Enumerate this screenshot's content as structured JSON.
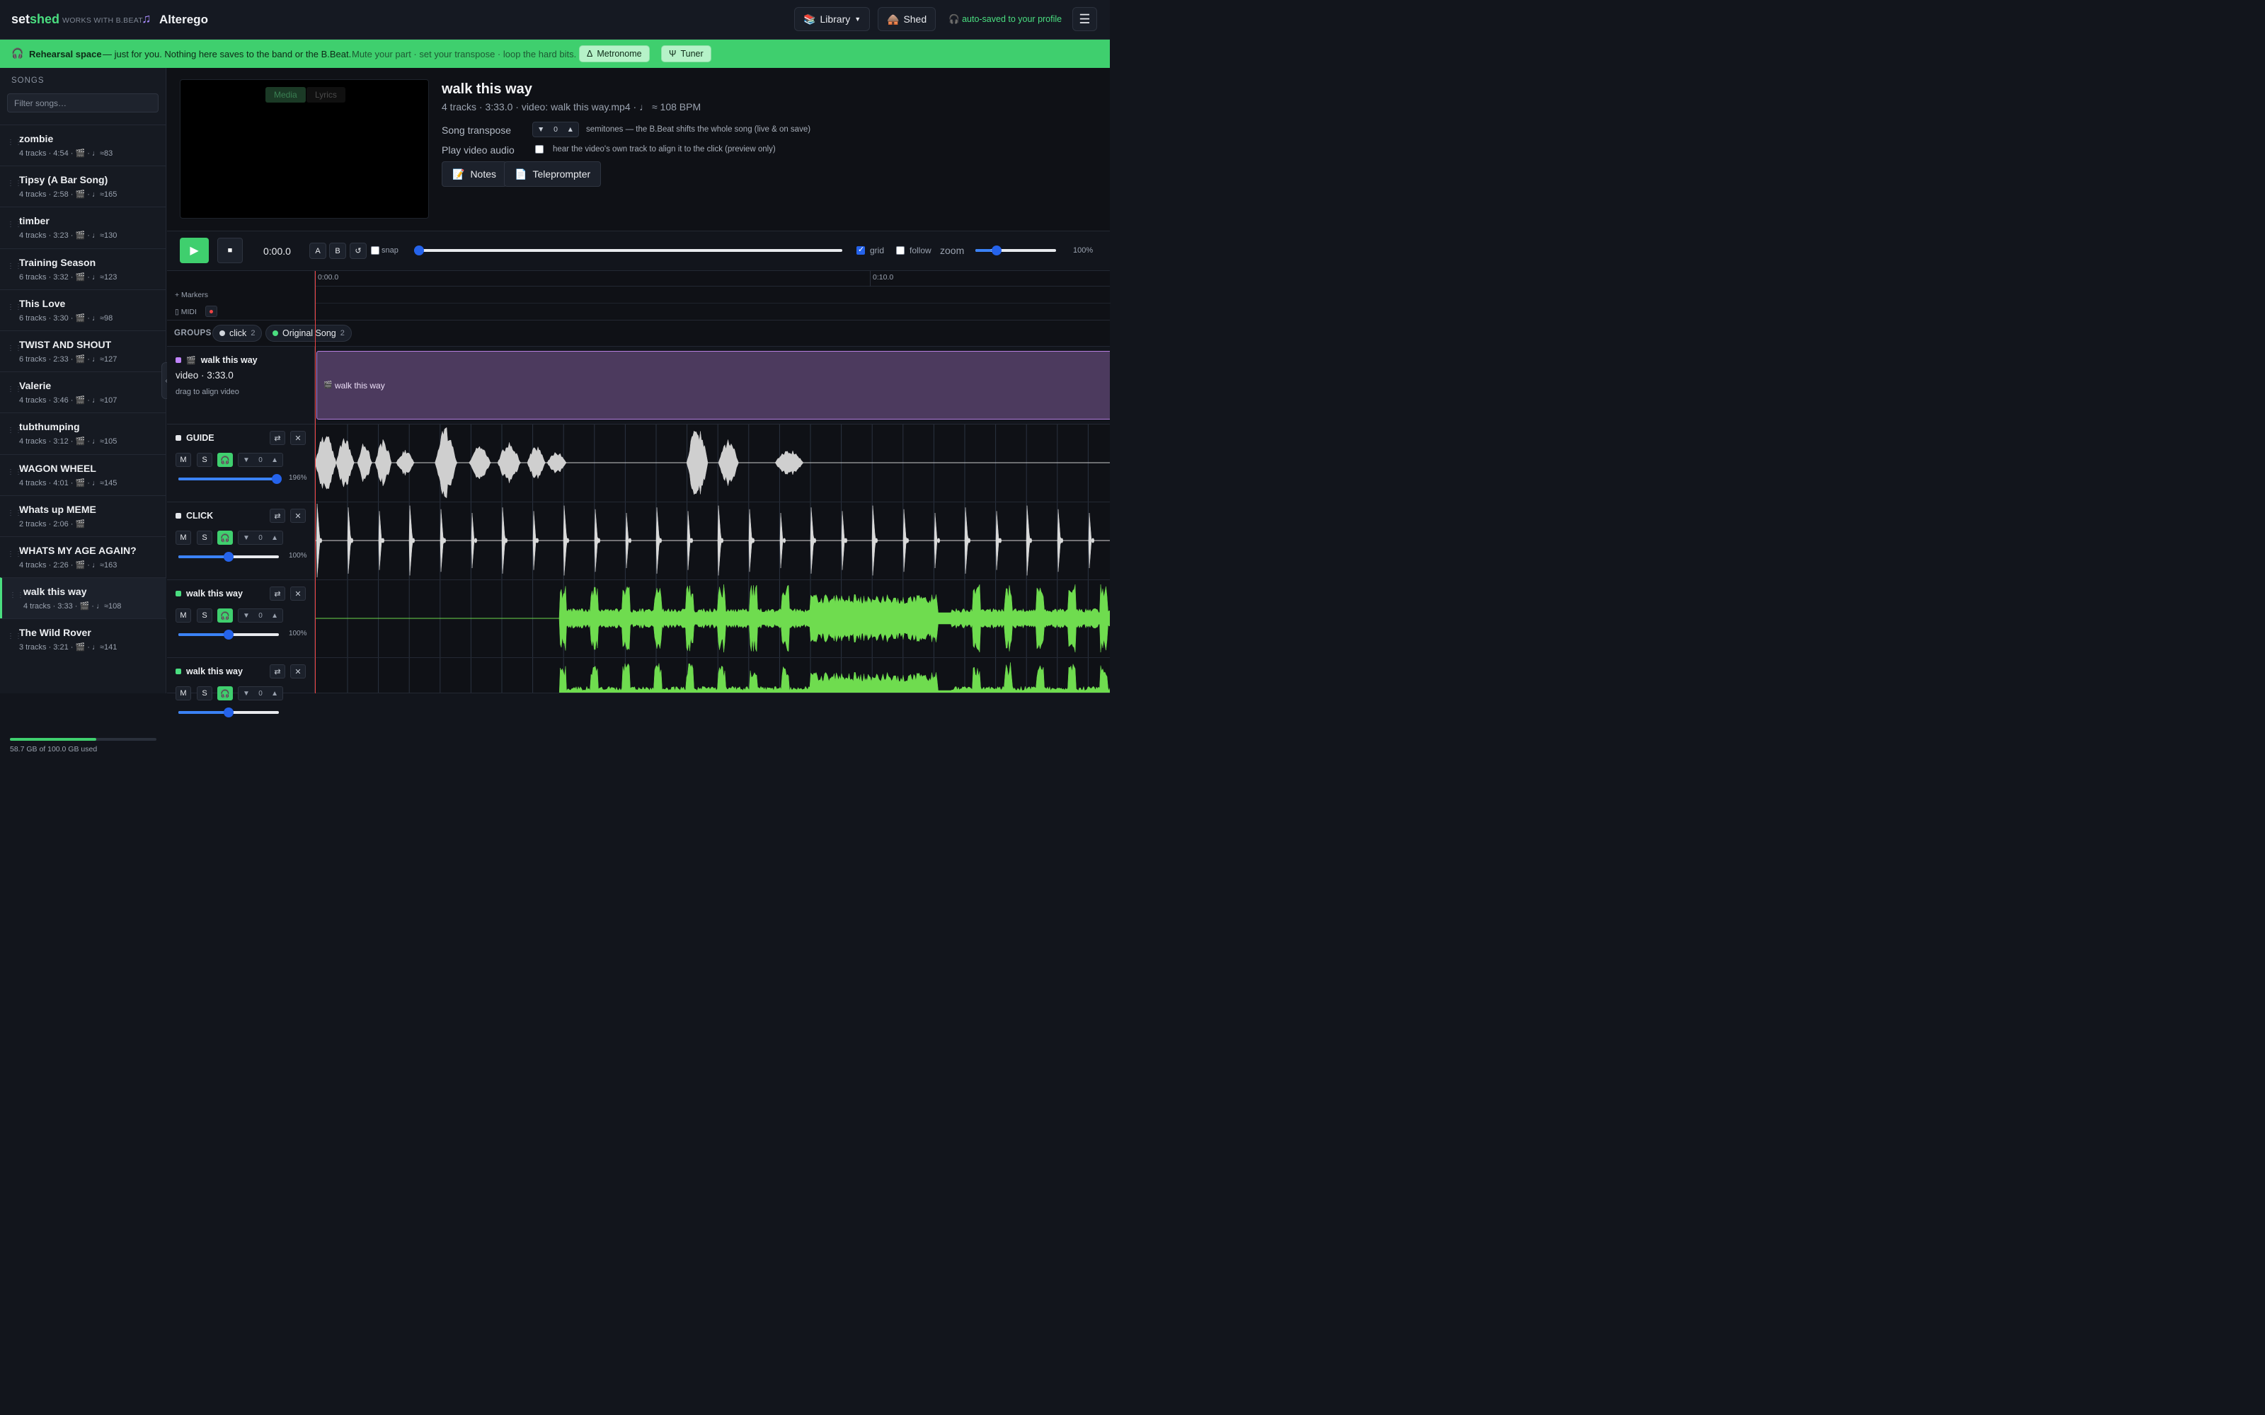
{
  "header": {
    "logo_a": "set",
    "logo_b": "shed",
    "works_with": "WORKS WITH B.BEAT",
    "band_name": "Alterego",
    "library_label": "Library",
    "shed_label": "Shed",
    "saved_status": "auto-saved to your profile"
  },
  "banner": {
    "bold": "Rehearsal space",
    "text": "— just for you. Nothing here saves to the band or the B.Beat.",
    "muted": "Mute your part · set your transpose · loop the hard bits.",
    "metronome_label": "Metronome",
    "tuner_label": "Tuner"
  },
  "sidebar": {
    "heading": "SONGS",
    "filter_placeholder": "Filter songs…",
    "songs": [
      {
        "title": "zombie",
        "meta": "4 tracks · 4:54 · 🎬 · ♩≈83"
      },
      {
        "title": "Tipsy (A Bar Song)",
        "meta": "4 tracks · 2:58 · 🎬 · ♩≈165"
      },
      {
        "title": "timber",
        "meta": "4 tracks · 3:23 · 🎬 · ♩≈130"
      },
      {
        "title": "Training Season",
        "meta": "6 tracks · 3:32 · 🎬 · ♩≈123"
      },
      {
        "title": "This Love",
        "meta": "6 tracks · 3:30 · 🎬 · ♩≈98"
      },
      {
        "title": "TWIST AND SHOUT",
        "meta": "6 tracks · 2:33 · 🎬 · ♩≈127"
      },
      {
        "title": "Valerie",
        "meta": "4 tracks · 3:46 · 🎬 · ♩≈107"
      },
      {
        "title": "tubthumping",
        "meta": "4 tracks · 3:12 · 🎬 · ♩≈105"
      },
      {
        "title": "WAGON WHEEL",
        "meta": "4 tracks · 4:01 · 🎬 · ♩≈145"
      },
      {
        "title": "Whats up MEME",
        "meta": "2 tracks · 2:06 · 🎬"
      },
      {
        "title": "WHATS MY AGE AGAIN?",
        "meta": "4 tracks · 2:26 · 🎬 · ♩≈163"
      },
      {
        "title": "walk this way",
        "meta": "4 tracks · 3:33 · 🎬 · ♩≈108",
        "active": true
      },
      {
        "title": "The Wild Rover",
        "meta": "3 tracks · 3:21 · 🎬 · ♩≈141"
      }
    ],
    "storage_text": "58.7 GB of 100.0 GB used",
    "storage_fraction": 0.587
  },
  "media": {
    "tab_media": "Media",
    "tab_lyrics": "Lyrics"
  },
  "song": {
    "title": "walk this way",
    "meta": "4 tracks · 3:33.0 · video: walk this way.mp4 · ♩ ≈ 108 BPM",
    "transpose_label": "Song transpose",
    "transpose_value": "0",
    "transpose_hint": "semitones — the B.Beat shifts the whole song (live & on save)",
    "video_audio_label": "Play video audio",
    "video_audio_hint": "hear the video's own track to align it to the click (preview only)",
    "notes_label": "Notes",
    "teleprompter_label": "Teleprompter"
  },
  "transport": {
    "time": "0:00.0",
    "a_label": "A",
    "b_label": "B",
    "snap_label": "snap",
    "grid_label": "grid",
    "follow_label": "follow",
    "zoom_label": "zoom",
    "zoom_pct": "100%",
    "position_fraction": 0.0,
    "zoom_fraction": 0.2
  },
  "timeline": {
    "tick0": "0:00.0",
    "tick1": "0:10.0",
    "markers_label": "+ Markers",
    "midi_label": "MIDI"
  },
  "groups": {
    "heading": "GROUPS",
    "items": [
      {
        "name": "click",
        "count": "2",
        "color": "#d1d5db"
      },
      {
        "name": "Original Song",
        "count": "2",
        "color": "#4ade80"
      }
    ]
  },
  "tracks": {
    "video": {
      "name": "walk this way",
      "info": "video · 3:33.0",
      "hint": "drag to align video",
      "clip_label": "walk this way",
      "color": "#c084fc"
    },
    "items": [
      {
        "name": "GUIDE",
        "mute": "M",
        "solo": "S",
        "transpose": "0",
        "volume_pct": "196%",
        "volume_fraction": 0.98,
        "color": "#e5e7eb",
        "wave": "#cfcfcf"
      },
      {
        "name": "CLICK",
        "mute": "M",
        "solo": "S",
        "transpose": "0",
        "volume_pct": "100%",
        "volume_fraction": 0.5,
        "color": "#e5e7eb",
        "wave": "#d9d9d9"
      },
      {
        "name": "walk this way",
        "mute": "M",
        "solo": "S",
        "transpose": "0",
        "volume_pct": "100%",
        "volume_fraction": 0.5,
        "color": "#4ade80",
        "wave": "#6fdc4f"
      },
      {
        "name": "walk this way",
        "mute": "M",
        "solo": "S",
        "transpose": "0",
        "volume_pct": "",
        "volume_fraction": 0.5,
        "color": "#4ade80",
        "wave": "#6fdc4f"
      }
    ]
  }
}
